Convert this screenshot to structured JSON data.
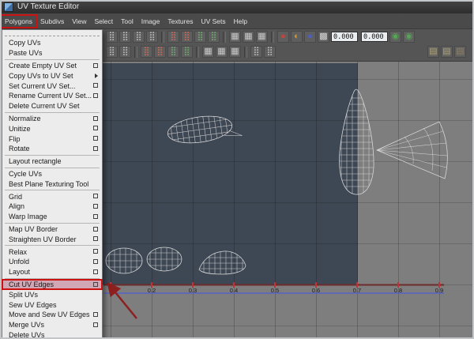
{
  "colors": {
    "accent_red": "#cc1111",
    "uv_bg": "#3e4754",
    "canvas_bg": "#7e7e7e",
    "wireframe": "#dcdcdc",
    "axis_maroon": "#6e2b2b",
    "tick_red": "#c23434",
    "baseline_blue": "#4f5fd4",
    "menu_bg": "#ececec",
    "highlight_pink": "#d2a7b5",
    "menubar_bg": "#4a4a4a",
    "toolbar_bg": "#555555"
  },
  "window": {
    "title": "UV Texture Editor"
  },
  "menubar": {
    "items": [
      {
        "label": "Polygons",
        "name": "menu-polygons",
        "classes": "annotated"
      },
      {
        "label": "Subdivs",
        "name": "menu-subdivs"
      },
      {
        "label": "View",
        "name": "menu-view"
      },
      {
        "label": "Select",
        "name": "menu-select"
      },
      {
        "label": "Tool",
        "name": "menu-tool"
      },
      {
        "label": "Image",
        "name": "menu-image"
      },
      {
        "label": "Textures",
        "name": "menu-textures"
      },
      {
        "label": "UV Sets",
        "name": "menu-uv-sets"
      },
      {
        "label": "Help",
        "name": "menu-help"
      }
    ]
  },
  "toolbar": {
    "value_field_1": "0.000",
    "value_field_2": "0.000",
    "row1_left": [
      {
        "name": "uv-move-icon",
        "glyph": "⣿",
        "color": "#bfbfbf"
      },
      {
        "name": "uv-rotate-icon",
        "glyph": "⣿",
        "color": "#bfbfbf"
      },
      {
        "name": "uv-scale-icon",
        "glyph": "⣿",
        "color": "#bfbfbf"
      },
      {
        "name": "uv-lattice-icon",
        "glyph": "⣿",
        "color": "#bfbfbf"
      },
      {
        "classes": "sep"
      },
      {
        "name": "flip-u-icon",
        "glyph": "⣿",
        "color": "#cf6a5a"
      },
      {
        "name": "flip-v-icon",
        "glyph": "⣿",
        "color": "#cf6a5a"
      },
      {
        "name": "rotate-uv-ccw-icon",
        "glyph": "⣿",
        "color": "#6fae6f"
      },
      {
        "name": "rotate-uv-cw-icon",
        "glyph": "⣿",
        "color": "#6fae6f"
      },
      {
        "classes": "sep"
      },
      {
        "name": "cut-uv-tool-icon",
        "glyph": "▦",
        "color": "#c9c9c9"
      },
      {
        "name": "sew-uv-tool-icon",
        "glyph": "▦",
        "color": "#c9c9c9"
      },
      {
        "name": "grid-snap-icon",
        "glyph": "▦",
        "color": "#c9c9c9"
      },
      {
        "classes": "sep"
      },
      {
        "name": "texture-red-icon",
        "glyph": "●",
        "color": "#c4433a"
      },
      {
        "name": "texture-ramp-icon",
        "glyph": "◐",
        "color": "#cf9a3a"
      },
      {
        "name": "texture-blue-icon",
        "glyph": "●",
        "color": "#4a5fc4"
      },
      {
        "name": "checker-display-icon",
        "glyph": "▩",
        "color": "#d8d8d8"
      }
    ],
    "row1_right": [
      {
        "name": "refresh-uv-icon",
        "glyph": "◉",
        "color": "#57a457"
      },
      {
        "name": "update-uv-icon",
        "glyph": "◉",
        "color": "#57a457"
      }
    ],
    "row2_left": [
      {
        "name": "select-face-icon",
        "glyph": "⣿",
        "color": "#bfbfbf"
      },
      {
        "name": "select-edge-icon",
        "glyph": "⣿",
        "color": "#bfbfbf"
      },
      {
        "classes": "sep"
      },
      {
        "name": "pin-uv-icon",
        "glyph": "⣿",
        "color": "#cf6a5a"
      },
      {
        "name": "unpin-uv-icon",
        "glyph": "⣿",
        "color": "#cf6a5a"
      },
      {
        "name": "overlap-display-icon",
        "glyph": "⣿",
        "color": "#6fae6f"
      },
      {
        "name": "distortion-display-icon",
        "glyph": "⣿",
        "color": "#6fae6f"
      },
      {
        "classes": "sep"
      },
      {
        "name": "tile-display-icon",
        "glyph": "▦",
        "color": "#c9c9c9"
      },
      {
        "name": "border-display-icon",
        "glyph": "▦",
        "color": "#c9c9c9"
      },
      {
        "name": "texture-display-icon",
        "glyph": "▦",
        "color": "#c9c9c9"
      },
      {
        "classes": "sep"
      },
      {
        "name": "isolate-select-icon",
        "glyph": "⣿",
        "color": "#bfbfbf"
      },
      {
        "name": "isolate-add-icon",
        "glyph": "⣿",
        "color": "#bfbfbf"
      }
    ],
    "row2_right": [
      {
        "name": "copy-uv-icon",
        "glyph": "▤",
        "color": "#b3a476"
      },
      {
        "name": "paste-uv-icon",
        "glyph": "▤",
        "color": "#b3a476"
      },
      {
        "name": "paste-uv-option-icon",
        "glyph": "▤",
        "color": "#8f8468"
      }
    ]
  },
  "polygons_menu": {
    "items": [
      {
        "label": "Copy UVs"
      },
      {
        "label": "Paste UVs"
      },
      {
        "classes": "separator"
      },
      {
        "label": "Create Empty UV Set",
        "classes": "has-option"
      },
      {
        "label": "Copy UVs to UV Set",
        "classes": "has-submenu"
      },
      {
        "label": "Set Current UV Set...",
        "classes": "has-option"
      },
      {
        "label": "Rename Current UV Set...",
        "classes": "has-option"
      },
      {
        "label": "Delete Current UV Set"
      },
      {
        "classes": "separator"
      },
      {
        "label": "Normalize",
        "classes": "has-option"
      },
      {
        "label": "Unitize",
        "classes": "has-option"
      },
      {
        "label": "Flip",
        "classes": "has-option"
      },
      {
        "label": "Rotate",
        "classes": "has-option"
      },
      {
        "classes": "separator"
      },
      {
        "label": "Layout rectangle"
      },
      {
        "classes": "separator"
      },
      {
        "label": "Cycle UVs"
      },
      {
        "label": "Best Plane Texturing Tool"
      },
      {
        "classes": "separator"
      },
      {
        "label": "Grid",
        "classes": "has-option"
      },
      {
        "label": "Align",
        "classes": "has-option"
      },
      {
        "label": "Warp Image",
        "classes": "has-option"
      },
      {
        "classes": "separator"
      },
      {
        "label": "Map UV Border",
        "classes": "has-option"
      },
      {
        "label": "Straighten UV Border",
        "classes": "has-option"
      },
      {
        "classes": "separator"
      },
      {
        "label": "Relax",
        "classes": "has-option"
      },
      {
        "label": "Unfold",
        "classes": "has-option"
      },
      {
        "label": "Layout",
        "classes": "has-option"
      },
      {
        "classes": "separator"
      },
      {
        "label": "Cut UV Edges",
        "name": "menu-item-cut-uv-edges",
        "classes": "has-option highlighted annotated"
      },
      {
        "label": "Split UVs"
      },
      {
        "label": "Sew UV Edges"
      },
      {
        "label": "Move and Sew UV Edges",
        "classes": "has-option"
      },
      {
        "label": "Merge UVs",
        "classes": "has-option"
      },
      {
        "label": "Delete UVs"
      }
    ]
  },
  "canvas": {
    "axis_labels": [
      "0.2",
      "0.3",
      "0.4",
      "0.5",
      "0.6",
      "0.7",
      "0.8",
      "0.9"
    ]
  }
}
